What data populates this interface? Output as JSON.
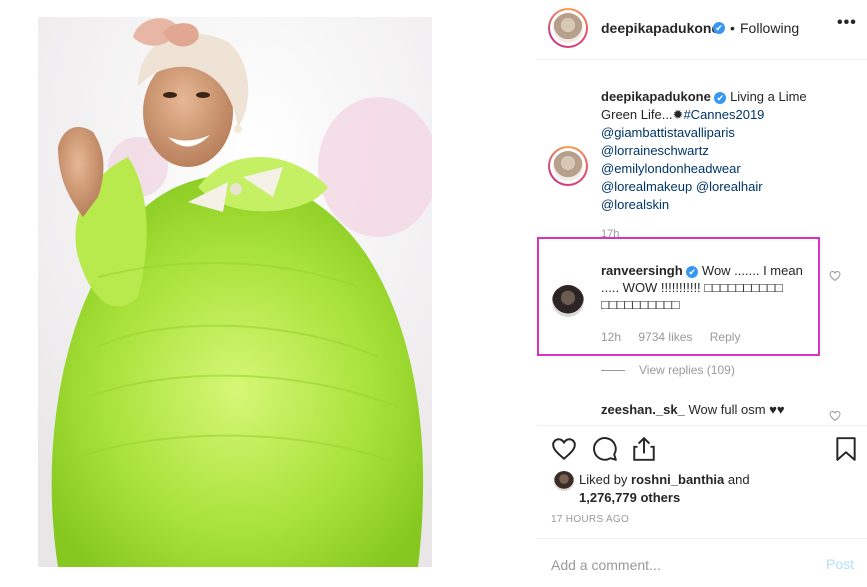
{
  "post": {
    "photo_alt": "",
    "header": {
      "username": "deepikapadukone",
      "verified_mark": "✔",
      "separator": "•",
      "follow_status": "Following",
      "more_label": "•••"
    },
    "caption": {
      "username": "deepikapadukone",
      "text": "Living a Lime Green Life...",
      "hashtag": "#Cannes2019",
      "mentions": [
        "@giambattistavalliparis",
        "@lorraineschwartz",
        "@emilylondonheadwear",
        "@lorealmakeup",
        "@lorealhair",
        "@lorealskin"
      ],
      "time": "17h"
    },
    "highlighted_comment": {
      "username": "ranveersingh",
      "text": "Wow ....... I mean ..... WOW !!!!!!!!!!! □□□□□□□□□□ □□□□□□□□□□",
      "time": "12h",
      "likes": "9734 likes",
      "reply_label": "Reply"
    },
    "view_replies": "View replies (109)",
    "second_comment": {
      "username": "zeeshan._sk_",
      "text": "Wow full osm ♥♥"
    },
    "likes": {
      "prefix": "Liked by",
      "liker": "roshni_banthia",
      "joiner": "and",
      "others": "1,276,779 others"
    },
    "timestamp": "17 HOURS AGO",
    "add_comment_placeholder": "Add a comment...",
    "post_button": "Post",
    "icons": {
      "like": "heart-outline-icon",
      "comment": "speech-bubble-icon",
      "share": "share-icon",
      "save": "bookmark-icon",
      "comment_like": "small-heart-icon"
    },
    "colors": {
      "highlight_border": "#d633c6",
      "verified": "#3897f0",
      "link": "#003569",
      "muted": "#999999",
      "post_disabled": "#b2dffc"
    }
  }
}
